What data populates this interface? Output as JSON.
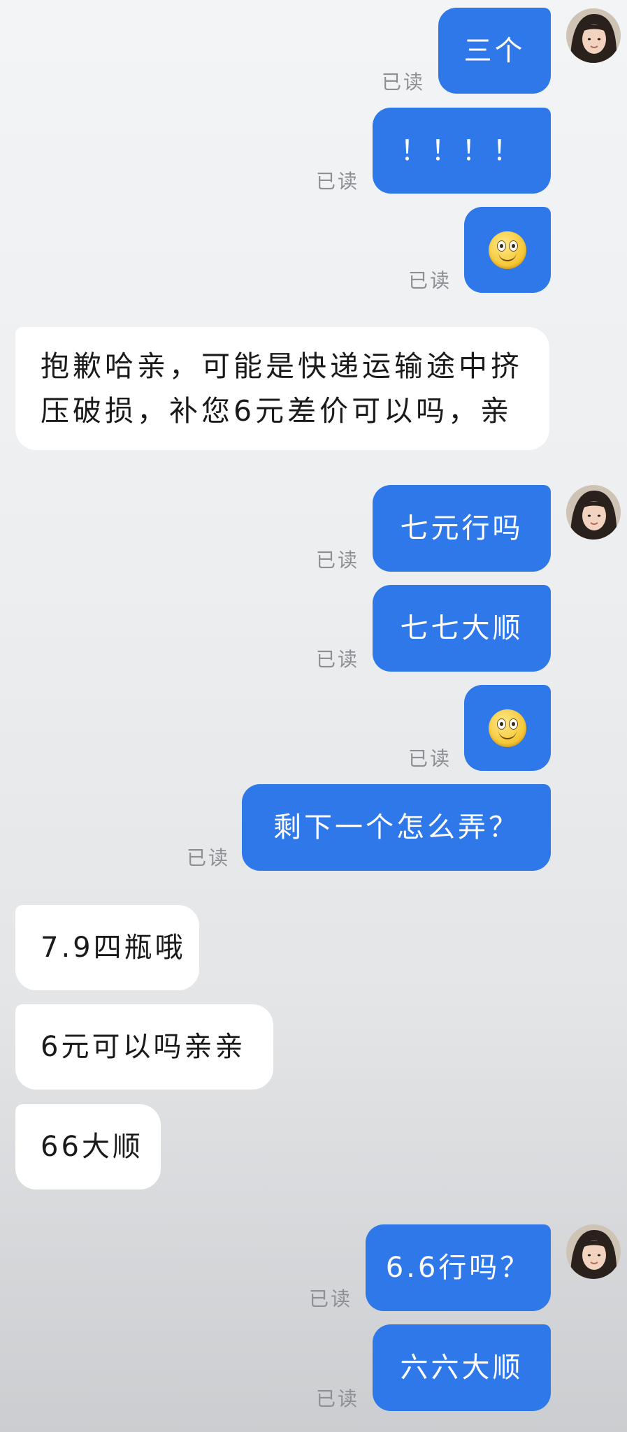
{
  "conversation": {
    "read_status": "已读",
    "messages": [
      {
        "id": "m1",
        "from": "me",
        "text": "三个"
      },
      {
        "id": "m2",
        "from": "me",
        "text": "！！！！"
      },
      {
        "id": "m3",
        "from": "me",
        "emoji": "smile-face-icon"
      },
      {
        "id": "m4",
        "from": "seller",
        "text": "抱歉哈亲，可能是快递运输途中挤压破损，补您6元差价可以吗，亲"
      },
      {
        "id": "m5",
        "from": "me",
        "text": "七元行吗"
      },
      {
        "id": "m6",
        "from": "me",
        "text": "七七大顺"
      },
      {
        "id": "m7",
        "from": "me",
        "emoji": "smile-face-icon"
      },
      {
        "id": "m8",
        "from": "me",
        "text": "剩下一个怎么弄？"
      },
      {
        "id": "m9",
        "from": "seller",
        "text": "7.9四瓶哦"
      },
      {
        "id": "m10",
        "from": "seller",
        "text": "6元可以吗亲亲"
      },
      {
        "id": "m11",
        "from": "seller",
        "text": "66大顺"
      },
      {
        "id": "m12",
        "from": "me",
        "text": "6.6行吗？"
      },
      {
        "id": "m13",
        "from": "me",
        "text": "六六大顺"
      }
    ]
  },
  "colors": {
    "sent_bubble": "#2f78e9",
    "received_bubble": "#ffffff",
    "read_text": "#8c8f94"
  }
}
